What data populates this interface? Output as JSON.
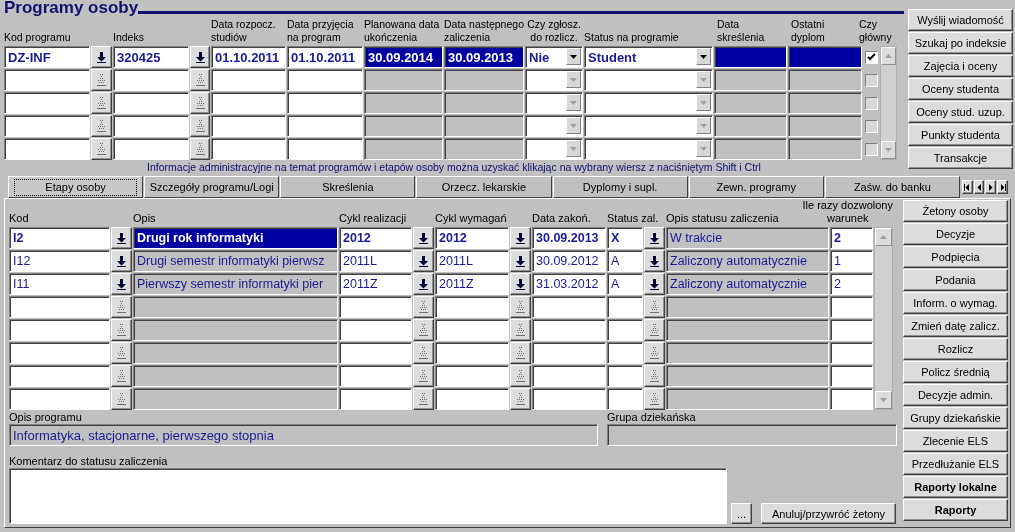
{
  "programs": {
    "title": "Programy osoby",
    "columns": [
      {
        "header": "Kod programu",
        "kind": "input",
        "lov": true
      },
      {
        "header": "Indeks",
        "kind": "input",
        "lov": true
      },
      {
        "header": "Data rozpocz.\nstudiów",
        "kind": "input",
        "lov": false
      },
      {
        "header": "Data przyjęcia\nna program",
        "kind": "input",
        "lov": false
      },
      {
        "header": "Planowana data\nukończenia",
        "kind": "marked",
        "lov": false
      },
      {
        "header": "Data następnego\nzaliczenia",
        "kind": "marked",
        "lov": false
      },
      {
        "header": "Czy zgłosz.\ndo rozlicz.",
        "kind": "combo",
        "lov": false
      },
      {
        "header": "Status na programie",
        "kind": "combo",
        "lov": false
      },
      {
        "header": "Data\nskreślenia",
        "kind": "marked",
        "lov": false
      },
      {
        "header": "Ostatni\ndyplom",
        "kind": "marked",
        "lov": false
      },
      {
        "header": "Czy\ngłówny",
        "kind": "check",
        "lov": false
      }
    ],
    "rows": [
      {
        "selected": true,
        "checked": true,
        "cells": [
          "DZ-INF",
          "320425",
          "01.10.2011",
          "01.10.2011",
          "30.09.2014",
          "30.09.2013",
          "Nie",
          "Student",
          "",
          ""
        ]
      },
      {
        "selected": false,
        "checked": false
      },
      {
        "selected": false,
        "checked": false
      },
      {
        "selected": false,
        "checked": false
      },
      {
        "selected": false,
        "checked": false
      }
    ]
  },
  "top_buttons": [
    {
      "label": "Wyślij wiadomość",
      "emphasized": false
    },
    {
      "label": "Szukaj po indeksie",
      "emphasized": false
    },
    {
      "label": "Zajęcia i oceny",
      "emphasized": false
    },
    {
      "label": "Oceny studenta",
      "emphasized": false
    },
    {
      "label": "Oceny stud. uzup.",
      "emphasized": false
    },
    {
      "label": "Punkty studenta",
      "emphasized": false
    },
    {
      "label": "Transakcje",
      "emphasized": false
    }
  ],
  "info_text": "Informacje administracyjne na temat programów i etapów osoby można uzyskać klikając na wybrany wiersz z naciśniętym Shift i Ctrl",
  "tabs": [
    {
      "label": "Etapy osoby",
      "selected": true
    },
    {
      "label": "Szczegóły programu/Logi",
      "selected": false
    },
    {
      "label": "Skreślenia",
      "selected": false
    },
    {
      "label": "Orzecz. lekarskie",
      "selected": false
    },
    {
      "label": "Dyplomy i supl.",
      "selected": false
    },
    {
      "label": "Zewn. programy",
      "selected": false
    },
    {
      "label": "Zaśw. do banku",
      "selected": false
    }
  ],
  "stages": {
    "columns": [
      {
        "header": "Kod",
        "kind": "input",
        "lov": true
      },
      {
        "header": "Opis",
        "kind": "marked",
        "lov": false
      },
      {
        "header": "Cykl realizacji",
        "kind": "input",
        "lov": true
      },
      {
        "header": "Cykl wymagań",
        "kind": "input",
        "lov": true
      },
      {
        "header": "Data zakoń.",
        "kind": "input",
        "lov": false
      },
      {
        "header": "Status zal.",
        "kind": "input",
        "lov": true
      },
      {
        "header": "Opis statusu zaliczenia",
        "kind": "readonly",
        "lov": false
      },
      {
        "header": "Ile razy dozwolony\nwarunek",
        "kind": "input",
        "lov": false
      }
    ],
    "rows": [
      {
        "selected": true,
        "cells": [
          "I2",
          "Drugi rok informatyki",
          "2012",
          "2012",
          "30.09.2013",
          "X",
          "W trakcie",
          "2"
        ]
      },
      {
        "selected": false,
        "cells": [
          "I12",
          "Drugi semestr informatyki pierwsz",
          "2011L",
          "2011L",
          "30.09.2012",
          "A",
          "Zaliczony automatycznie",
          "1"
        ]
      },
      {
        "selected": false,
        "cells": [
          "I11",
          "Pierwszy semestr informatyki pier",
          "2011Z",
          "2011Z",
          "31.03.2012",
          "A",
          "Zaliczony automatycznie",
          "2"
        ]
      },
      {
        "selected": false
      },
      {
        "selected": false
      },
      {
        "selected": false
      },
      {
        "selected": false
      },
      {
        "selected": false
      }
    ]
  },
  "program_description": {
    "label": "Opis programu",
    "value": "Informatyka, stacjonarne, pierwszego stopnia"
  },
  "dean_group": {
    "label": "Grupa dziekańska"
  },
  "comment": {
    "label": "Komentarz do statusu zaliczenia"
  },
  "more_button": "...",
  "cancel_tokens_button": "Anuluj/przywróć żetony",
  "side_buttons": [
    {
      "label": "Żetony osoby",
      "emphasized": false
    },
    {
      "label": "Decyzje",
      "emphasized": false
    },
    {
      "label": "Podpięcia",
      "emphasized": false
    },
    {
      "label": "Podania",
      "emphasized": false
    },
    {
      "label": "Inform. o wymag.",
      "emphasized": false
    },
    {
      "label": "Zmień datę zalicz.",
      "emphasized": false
    },
    {
      "label": "Rozlicz",
      "emphasized": false
    },
    {
      "label": "Policz średnią",
      "emphasized": false
    },
    {
      "label": "Decyzje admin.",
      "emphasized": false
    },
    {
      "label": "Grupy dziekańskie",
      "emphasized": false
    },
    {
      "label": "Zlecenie ELS",
      "emphasized": false
    },
    {
      "label": "Przedłużanie ELS",
      "emphasized": false
    },
    {
      "label": "Raporty lokalne",
      "emphasized": true
    },
    {
      "label": "Raporty",
      "emphasized": true
    }
  ]
}
